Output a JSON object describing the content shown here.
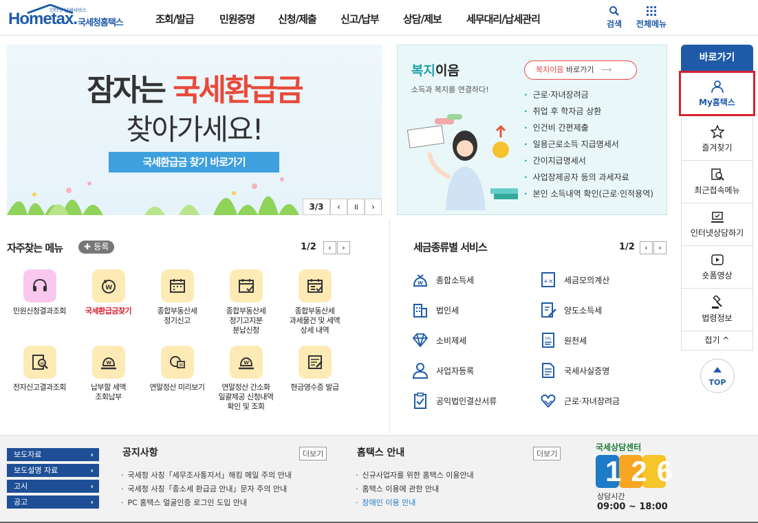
{
  "header": {
    "logo_word": "Hometax.",
    "logo_sub": "국세청홈택스",
    "logo_tiny": "인터넷 납세서비스",
    "nav": [
      "조회/발급",
      "민원증명",
      "신청/제출",
      "신고/납부",
      "상담/제보",
      "세무대리/납세관리"
    ],
    "search_label": "검색",
    "menu_label": "전체메뉴"
  },
  "banner": {
    "line1_a": "잠자는 ",
    "line1_b": "국세환급금",
    "line2": "찾아가세요!",
    "button": "국세환급금 찾기 바로가기",
    "page": "3/3",
    "prev": "‹",
    "pause": "॥",
    "next": "›",
    "colors": {
      "accent": "#e84a3a",
      "button": "#3ea0de"
    }
  },
  "welfare": {
    "title_a": "복지",
    "title_b": "이음",
    "subtitle": "소득과 복지를 연결하다!",
    "go_a": "복지이음",
    "go_b": " 바로가기",
    "items": [
      "근로·자녀장려금",
      "취업 후 학자금 상환",
      "인건비 간편제출",
      "일용근로소득 지급명세서",
      "간이지급명세서",
      "사업장제공자 등의 과세자료",
      "본인 소득내역 확인(근로·인적용역)"
    ]
  },
  "frequent": {
    "title": "자주찾는 메뉴",
    "add": "등록",
    "page": "1/2",
    "items": [
      {
        "label": "민원신청결과조회",
        "icon": "headset-icon"
      },
      {
        "label": "국세환급금찾기",
        "icon": "refund-icon"
      },
      {
        "label": "종합부동산세\n정기신고",
        "icon": "calendar-icon"
      },
      {
        "label": "종합부동산세\n정기고지분\n분납신청",
        "icon": "calendar-check-icon"
      },
      {
        "label": "종합부동산세\n과세물건 및 세액\n상세 내역",
        "icon": "calendar-list-icon"
      },
      {
        "label": "전자신고결과조회",
        "icon": "search-doc-icon"
      },
      {
        "label": "납부할 세액\n조회납부",
        "icon": "money-hand-icon"
      },
      {
        "label": "연말정산 미리보기",
        "icon": "preview-icon"
      },
      {
        "label": "연말정산 간소화\n일괄제공 신청내역\n확인 및 조회",
        "icon": "money-hand-icon"
      },
      {
        "label": "현금영수증 발급",
        "icon": "receipt-icon"
      }
    ]
  },
  "taxservice": {
    "title": "세금종류별 서비스",
    "page": "1/2",
    "left": [
      "종합소득세",
      "법인세",
      "소비제세",
      "사업자등록",
      "공익법인결산서류"
    ],
    "right": [
      "세금모의계산",
      "양도소득세",
      "원천세",
      "국세사실증명",
      "근로·자녀장려금"
    ]
  },
  "quick": {
    "head": "바로가기",
    "items": [
      "My홈택스",
      "즐겨찾기",
      "최근접속메뉴",
      "인터넷상담하기",
      "숏폼영상",
      "법령정보"
    ],
    "fold": "접기 ^",
    "top": "TOP",
    "colors": {
      "highlight": "#d8202e",
      "brand": "#1e5aa8"
    }
  },
  "footer": {
    "links": [
      "보도자료",
      "보도설명 자료",
      "고시",
      "공고"
    ],
    "notice_title": "공지사항",
    "notice_more": "더보기",
    "notices": [
      "국세청 사칭「세무조사통지서」해킹 메일 주의 안내",
      "국세청 사칭「종소세 환급금 안내」문자 주의 안내",
      "PC 홈택스 얼굴인증 로그인 도입 안내"
    ],
    "guide_title": "홈택스 안내",
    "guide_more": "더보기",
    "guides": [
      "신규사업자를 위한 홈택스 이용안내",
      "홈택스 이용에 관한 안내",
      "장애인 이용 안내"
    ],
    "center_title": "국세상담센터",
    "center_number": "126",
    "hours_label": "상담시간",
    "hours": "09:00 ~ 18:00"
  }
}
